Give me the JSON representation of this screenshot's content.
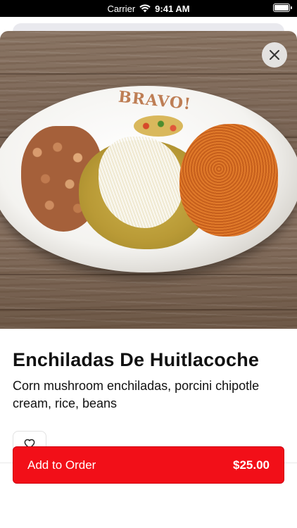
{
  "status_bar": {
    "carrier": "Carrier",
    "time": "9:41 AM",
    "wifi_icon": "wifi-icon",
    "battery_icon": "battery-icon"
  },
  "item": {
    "name": "Enchiladas De Huitlacoche",
    "description": "Corn mushroom enchiladas, porcini chipotle cream, rice, beans",
    "photo_logo": "BRAVO!",
    "favorite_icon": "heart-outline-icon",
    "close_icon": "close-icon"
  },
  "order_button": {
    "label": "Add to Order",
    "price": "$25.00"
  },
  "colors": {
    "accent": "#f20f18",
    "text": "#111111",
    "background": "#ffffff"
  }
}
